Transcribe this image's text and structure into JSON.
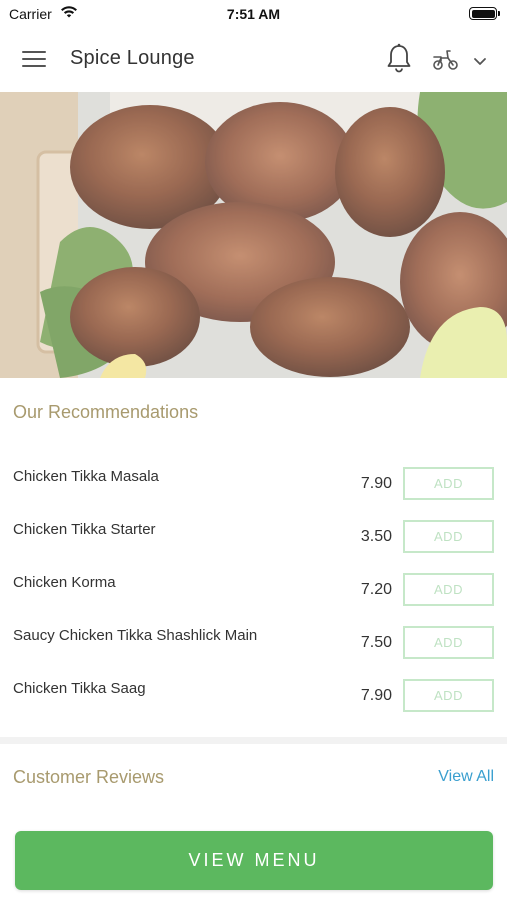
{
  "status_bar": {
    "carrier": "Carrier",
    "time": "7:51 AM"
  },
  "header": {
    "title": "Spice Lounge",
    "menu_icon": "hamburger-menu-icon",
    "notification_icon": "bell-icon",
    "delivery_icon": "scooter-icon",
    "dropdown_icon": "chevron-down-icon"
  },
  "hero": {
    "description_icon": "food-photo"
  },
  "recommendations": {
    "title": "Our Recommendations",
    "add_label": "ADD",
    "items": [
      {
        "name": "Chicken Tikka Masala",
        "price": "7.90"
      },
      {
        "name": "Chicken Tikka Starter",
        "price": "3.50"
      },
      {
        "name": "Chicken Korma",
        "price": "7.20"
      },
      {
        "name": "Saucy Chicken Tikka Shashlick Main",
        "price": "7.50"
      },
      {
        "name": "Chicken Tikka Saag",
        "price": "7.90"
      }
    ]
  },
  "reviews": {
    "title": "Customer Reviews",
    "view_all": "View All"
  },
  "footer": {
    "view_menu": "VIEW MENU"
  },
  "colors": {
    "accent_green": "#5cb85f",
    "section_title": "#a89a6e",
    "link_blue": "#3a9fcf",
    "add_border": "#c6e8c9"
  }
}
